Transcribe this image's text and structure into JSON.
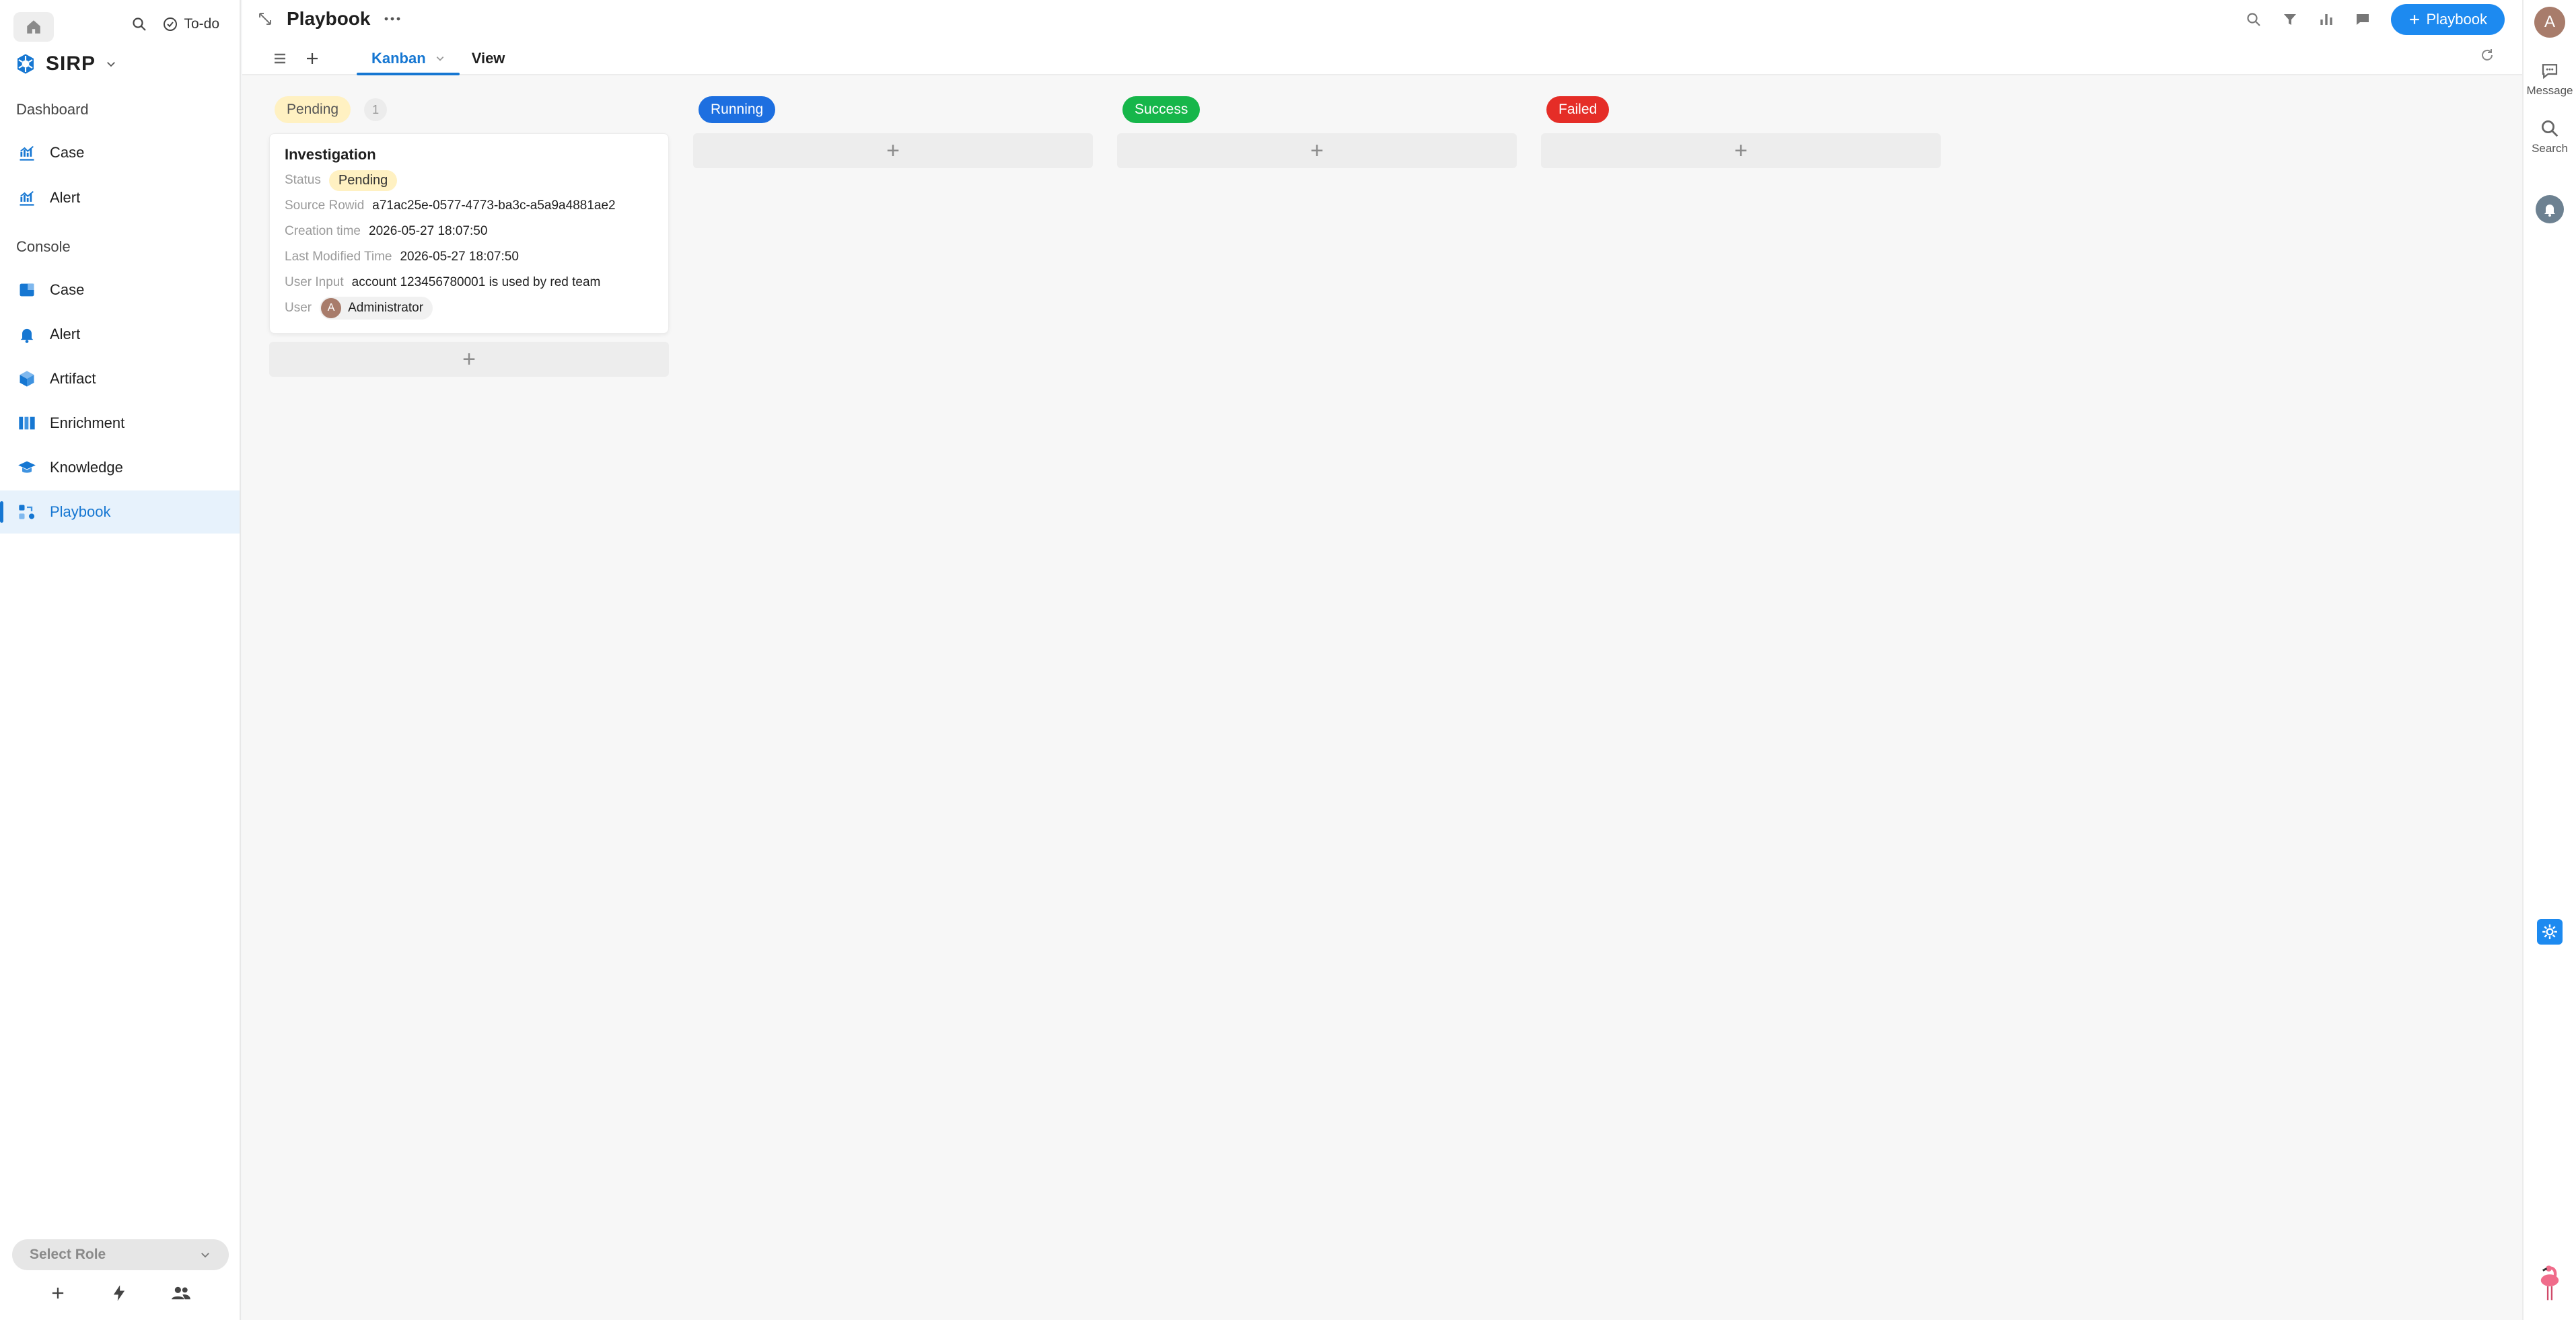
{
  "sidebar": {
    "todo_label": "To-do",
    "brand": "SIRP",
    "sections": [
      {
        "title": "Dashboard",
        "items": [
          {
            "label": "Case",
            "icon": "chart-icon"
          },
          {
            "label": "Alert",
            "icon": "chart-icon"
          }
        ]
      },
      {
        "title": "Console",
        "items": [
          {
            "label": "Case",
            "icon": "case-icon"
          },
          {
            "label": "Alert",
            "icon": "bell-icon"
          },
          {
            "label": "Artifact",
            "icon": "cube-icon"
          },
          {
            "label": "Enrichment",
            "icon": "columns-icon"
          },
          {
            "label": "Knowledge",
            "icon": "graduation-cap-icon"
          },
          {
            "label": "Playbook",
            "icon": "playbook-icon",
            "active": true
          }
        ]
      }
    ],
    "select_role": "Select Role"
  },
  "header": {
    "title": "Playbook",
    "tabs": {
      "kanban": "Kanban",
      "view": "View"
    },
    "new_button": "Playbook"
  },
  "board": {
    "columns": [
      {
        "label": "Pending",
        "count": "1",
        "color": "#fff1c2",
        "text_color": "#555555"
      },
      {
        "label": "Running",
        "color": "#1d6fe0",
        "text_color": "#ffffff"
      },
      {
        "label": "Success",
        "color": "#16b64a",
        "text_color": "#ffffff"
      },
      {
        "label": "Failed",
        "color": "#e52d27",
        "text_color": "#ffffff"
      }
    ],
    "card": {
      "title": "Investigation",
      "status_label": "Status",
      "status_value": "Pending",
      "source_rowid_label": "Source Rowid",
      "source_rowid_value": "a71ac25e-0577-4773-ba3c-a5a9a4881ae2",
      "creation_time_label": "Creation time",
      "creation_time_value": "2026-05-27 18:07:50",
      "last_modified_label": "Last Modified Time",
      "last_modified_value": "2026-05-27 18:07:50",
      "user_input_label": "User Input",
      "user_input_value": "account 123456780001 is used by red team",
      "user_label": "User",
      "user_initial": "A",
      "user_value": "Administrator"
    }
  },
  "rail": {
    "avatar_initial": "A",
    "message_label": "Message",
    "search_label": "Search"
  }
}
